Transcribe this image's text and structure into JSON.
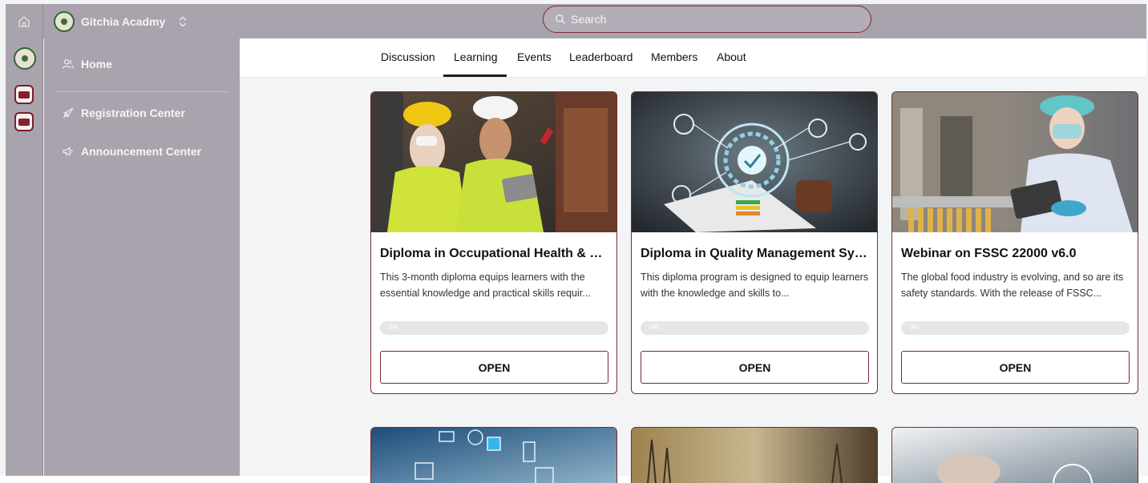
{
  "topbar": {
    "home_icon": "home-icon",
    "workspace_name": "Gitchia Acadmy",
    "workspace_switch_icon": "chevron-updown-icon",
    "search_placeholder": "Search"
  },
  "rail": {
    "items": [
      "academy-logo",
      "app-icon",
      "app-icon"
    ]
  },
  "sidebar": {
    "items": [
      {
        "label": "Home",
        "icon": "user-group-icon"
      },
      {
        "label": "Registration Center",
        "icon": "rocket-icon"
      },
      {
        "label": "Announcement Center",
        "icon": "megaphone-icon"
      }
    ]
  },
  "tabs": [
    {
      "label": "Discussion"
    },
    {
      "label": "Learning",
      "active": true
    },
    {
      "label": "Events"
    },
    {
      "label": "Leaderboard"
    },
    {
      "label": "Members"
    },
    {
      "label": "About"
    }
  ],
  "courses": [
    {
      "title": "Diploma in Occupational Health & Sa...",
      "description": "This 3-month diploma equips learners with the essential knowledge and practical skills requir...",
      "progress_label": "0%",
      "progress": 0,
      "button": "OPEN"
    },
    {
      "title": "Diploma in Quality Management Sys...",
      "description": "This diploma program is designed to equip learners with the knowledge and skills to...",
      "progress_label": "0%",
      "progress": 0,
      "button": "OPEN"
    },
    {
      "title": "Webinar on FSSC 22000 v6.0",
      "description": "The global food industry is evolving, and so are its safety standards. With the release of FSSC...",
      "progress_label": "0%",
      "progress": 0,
      "button": "OPEN"
    }
  ],
  "colors": {
    "accent": "#7a2a32",
    "sidebar_bg": "#a9a3ad",
    "page_bg": "#f3f4f6"
  }
}
